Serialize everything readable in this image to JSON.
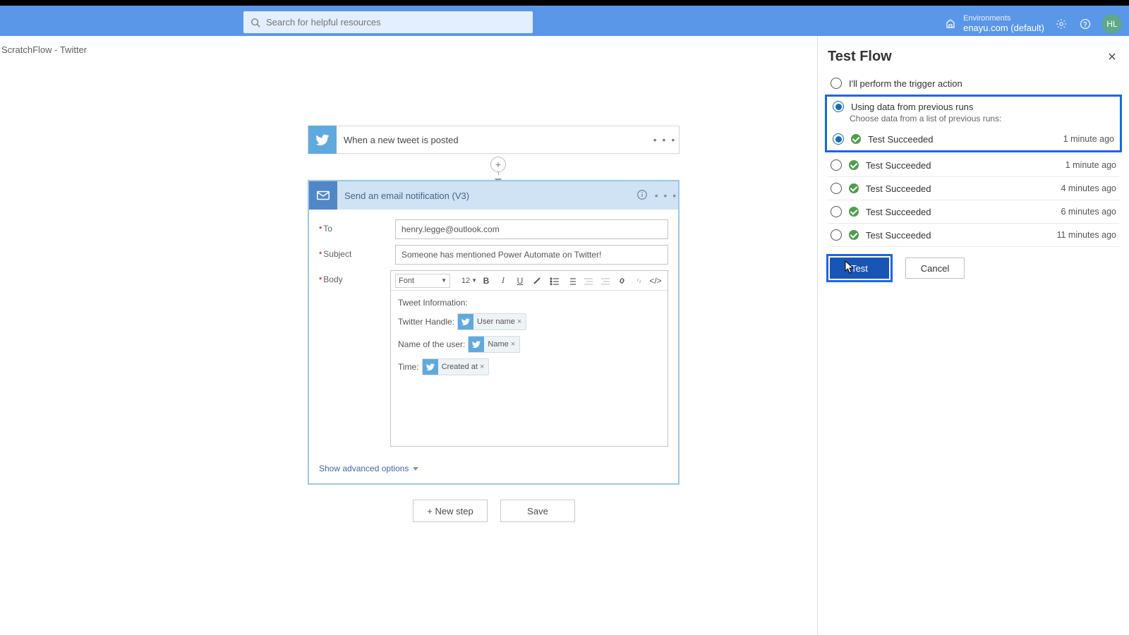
{
  "header": {
    "search_placeholder": "Search for helpful resources",
    "env_label": "Environments",
    "env_value": "enayu.com (default)",
    "avatar_initials": "HL"
  },
  "breadcrumb": "ScratchFlow - Twitter",
  "trigger": {
    "title": "When a new tweet is posted"
  },
  "action": {
    "title": "Send an email notification (V3)",
    "fields": {
      "to_label": "To",
      "to_value": "henry.legge@outlook.com",
      "subject_label": "Subject",
      "subject_value": "Someone has mentioned Power Automate on Twitter!",
      "body_label": "Body"
    },
    "editor": {
      "font_label": "Font",
      "font_size": "12",
      "intro": "Tweet Information:",
      "lines": [
        {
          "label": "Twitter Handle:",
          "token": "User name"
        },
        {
          "label": "Name of the user:",
          "token": "Name"
        },
        {
          "label": "Time:",
          "token": "Created at"
        }
      ]
    },
    "advanced": "Show advanced options"
  },
  "bottom": {
    "new_step": "+ New step",
    "save": "Save"
  },
  "panel": {
    "title": "Test Flow",
    "option_manual": "I'll perform the trigger action",
    "option_previous": "Using data from previous runs",
    "option_previous_sub": "Choose data from a list of previous runs:",
    "runs": [
      {
        "name": "Test Succeeded",
        "time": "1 minute ago",
        "selected": true
      },
      {
        "name": "Test Succeeded",
        "time": "1 minute ago",
        "selected": false
      },
      {
        "name": "Test Succeeded",
        "time": "4 minutes ago",
        "selected": false
      },
      {
        "name": "Test Succeeded",
        "time": "6 minutes ago",
        "selected": false
      },
      {
        "name": "Test Succeeded",
        "time": "11 minutes ago",
        "selected": false
      }
    ],
    "test_btn": "Test",
    "cancel_btn": "Cancel"
  }
}
